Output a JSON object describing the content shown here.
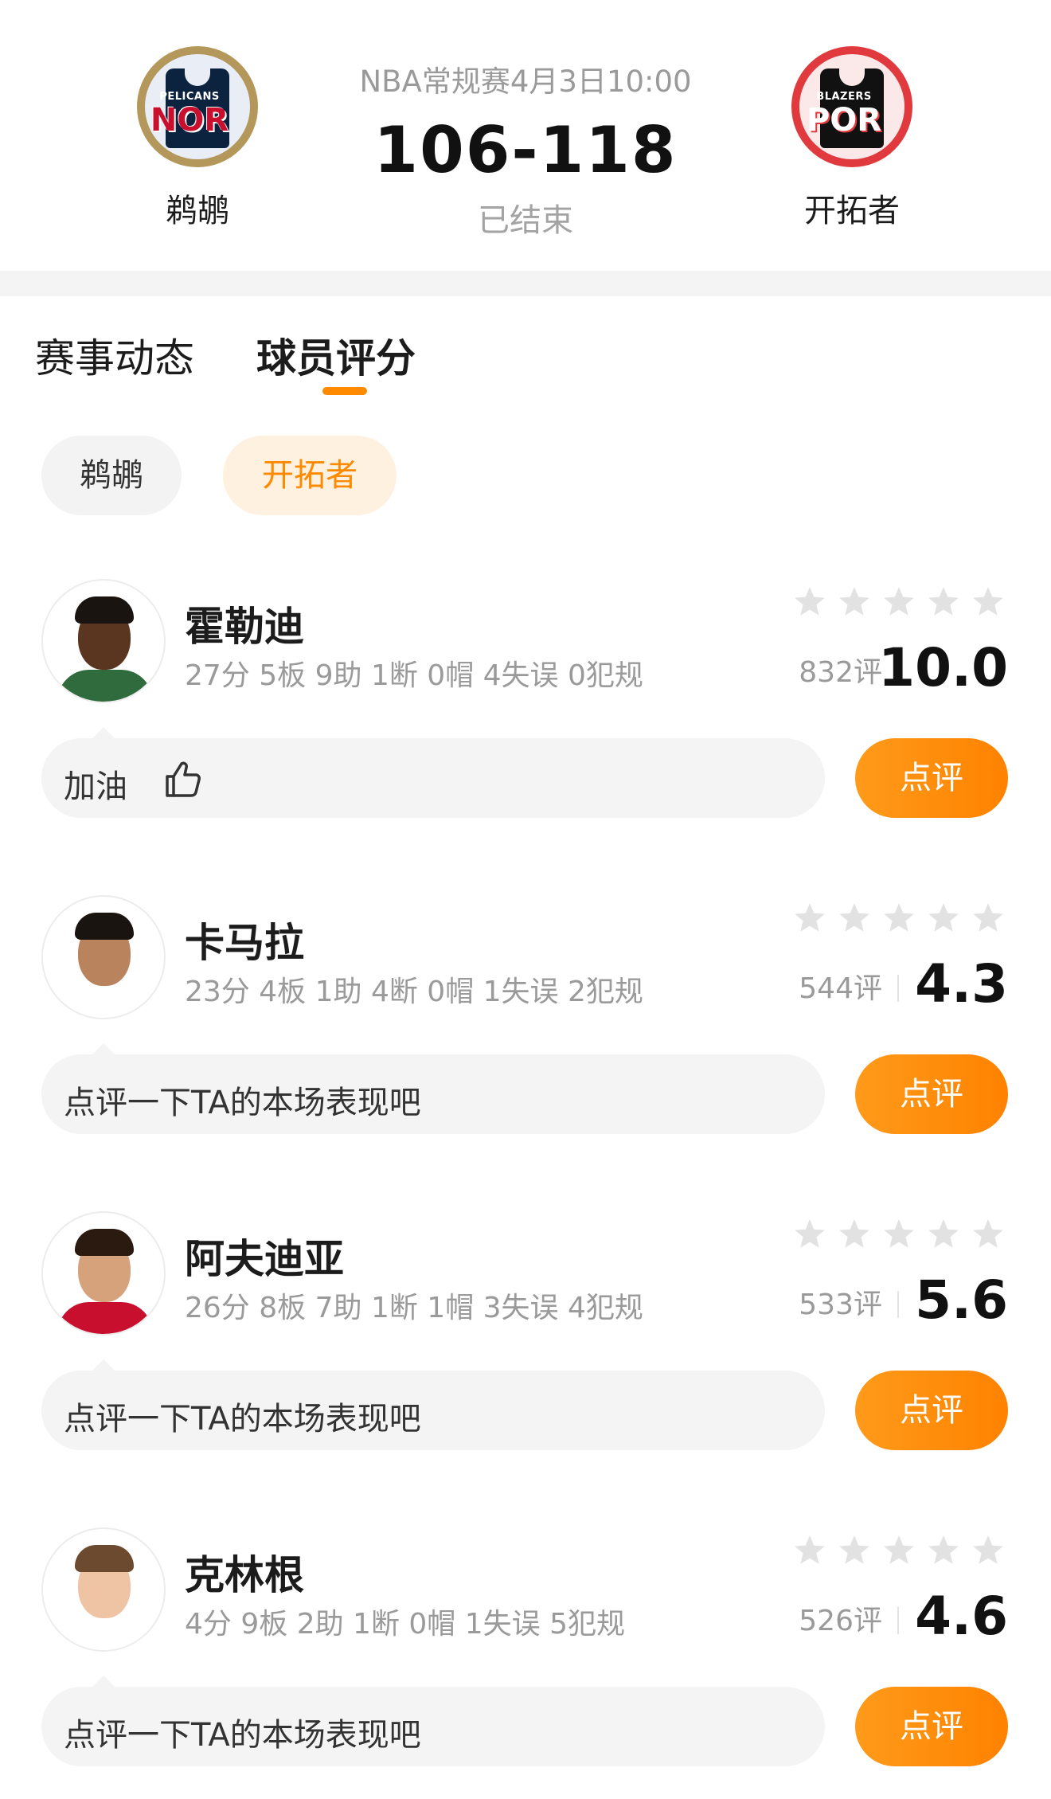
{
  "match": {
    "meta": "NBA常规赛4月3日10:00",
    "score": "106-118",
    "status": "已结束",
    "home": {
      "name": "鹈鹕",
      "logo_small": "PELICANS",
      "logo_abbr": "NOR"
    },
    "away": {
      "name": "开拓者",
      "logo_small": "BLAZERS",
      "logo_abbr": "POR"
    }
  },
  "tabs": [
    {
      "label": "赛事动态",
      "active": false
    },
    {
      "label": "球员评分",
      "active": true
    }
  ],
  "team_filter": [
    {
      "label": "鹈鹕",
      "selected": false
    },
    {
      "label": "开拓者",
      "selected": true
    }
  ],
  "players": [
    {
      "name": "霍勒迪",
      "stats": "27分 5板 9助 1断 0帽 4失误 0犯规",
      "review_count": "832评",
      "score": "10.0",
      "comment": "加油",
      "button": "点评",
      "stars_filled": 0
    },
    {
      "name": "卡马拉",
      "stats": "23分 4板 1助 4断 0帽 1失误 2犯规",
      "review_count": "544评",
      "score": "4.3",
      "comment": "点评一下TA的本场表现吧",
      "button": "点评",
      "stars_filled": 0
    },
    {
      "name": "阿夫迪亚",
      "stats": "26分 8板 7助 1断 1帽 3失误 4犯规",
      "review_count": "533评",
      "score": "5.6",
      "comment": "点评一下TA的本场表现吧",
      "button": "点评",
      "stars_filled": 0
    },
    {
      "name": "克林根",
      "stats": "4分 9板 2助 1断 0帽 1失误 5犯规",
      "review_count": "526评",
      "score": "4.6",
      "comment": "点评一下TA的本场表现吧",
      "button": "点评",
      "stars_filled": 0
    }
  ],
  "colors": {
    "accent": "#ff8a00",
    "chip_selected_bg": "#fff1e0",
    "star_empty": "#e2e2e2",
    "nor_primary": "#0c2340",
    "nor_gold": "#b4975a",
    "por_primary": "#e03a3e"
  },
  "icons": {
    "rating_star": "star-icon",
    "thumb": "thumbs-up-icon"
  }
}
